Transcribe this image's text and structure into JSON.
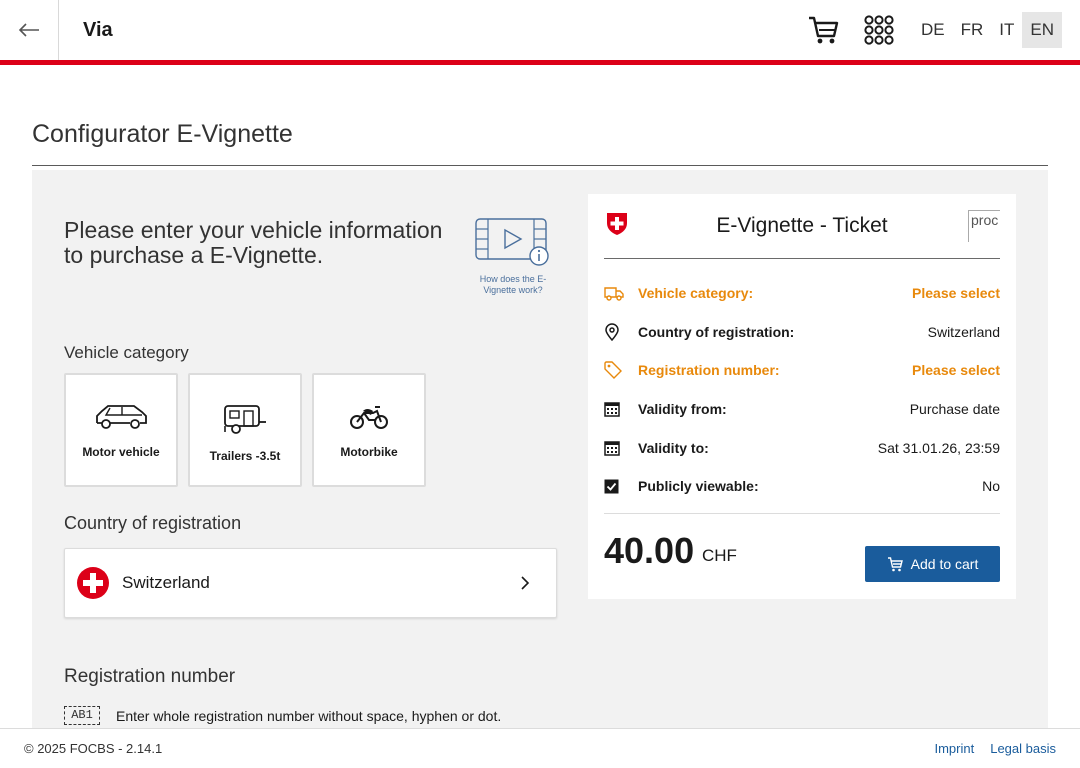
{
  "header": {
    "app_title": "Via",
    "back_icon": "arrow-left-icon",
    "cart_icon": "cart-icon",
    "apps_icon": "grid-icon",
    "languages": [
      "DE",
      "FR",
      "IT",
      "EN"
    ],
    "active_language": "EN",
    "accent_color": "#dc0018"
  },
  "page": {
    "title": "Configurator E-Vignette"
  },
  "intro": {
    "text": "Please enter your vehicle information to purchase a E-Vignette.",
    "video_help_label": "How does the E-Vignette work?"
  },
  "vehicle_category": {
    "label": "Vehicle category",
    "options": [
      {
        "label": "Motor vehicle",
        "icon": "car-icon"
      },
      {
        "label": "Trailers -3.5t",
        "icon": "trailer-icon"
      },
      {
        "label": "Motorbike",
        "icon": "motorbike-icon"
      }
    ]
  },
  "country": {
    "label": "Country of registration",
    "selected": "Switzerland",
    "flag_icon": "swiss-flag-icon"
  },
  "registration": {
    "label": "Registration number",
    "plate_icon_text": "AB1",
    "hint": "Enter whole registration number without space, hyphen or dot."
  },
  "ticket": {
    "title": "E-Vignette - Ticket",
    "image_alt": "proc",
    "rows": [
      {
        "label": "Vehicle category:",
        "value": "Please select",
        "icon": "truck-icon",
        "warn": true
      },
      {
        "label": "Country of registration:",
        "value": "Switzerland",
        "icon": "location-pin-icon",
        "warn": false
      },
      {
        "label": "Registration number:",
        "value": "Please select",
        "icon": "tag-icon",
        "warn": true
      },
      {
        "label": "Validity from:",
        "value": "Purchase date",
        "icon": "calendar-icon",
        "warn": false
      },
      {
        "label": "Validity to:",
        "value": "Sat 31.01.26, 23:59",
        "icon": "calendar-icon",
        "warn": false
      },
      {
        "label": "Publicly viewable:",
        "value": "No",
        "icon": "checkbox-icon",
        "warn": false
      }
    ],
    "price": "40.00",
    "currency": "CHF",
    "add_to_cart": "Add to cart",
    "warn_color": "#e8890c",
    "button_color": "#1a5c9c"
  },
  "footer": {
    "copyright": "© 2025 FOCBS - 2.14.1",
    "links": [
      "Imprint",
      "Legal basis"
    ]
  }
}
